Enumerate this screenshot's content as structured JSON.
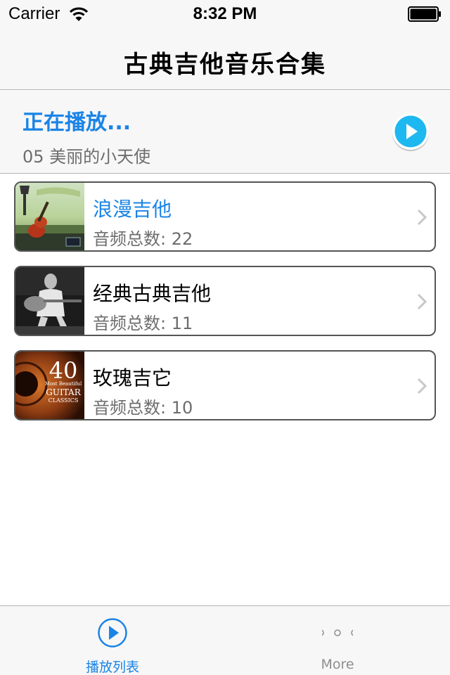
{
  "status_bar": {
    "carrier": "Carrier",
    "time": "8:32 PM"
  },
  "nav": {
    "title": "古典吉他音乐合集"
  },
  "now_playing": {
    "label": "正在播放...",
    "track": "05 美丽的小天使"
  },
  "albums": [
    {
      "title": "浪漫吉他",
      "count": "音频总数: 22",
      "active": true
    },
    {
      "title": "经典古典吉他",
      "count": "音频总数: 11",
      "active": false
    },
    {
      "title": "玫瑰吉它",
      "count": "音频总数: 10",
      "active": false
    }
  ],
  "cover3_text": {
    "number": "40",
    "line1": "Most Beautiful",
    "line2": "GUITAR",
    "line3": "CLASSICS"
  },
  "tabs": [
    {
      "label": "播放列表",
      "icon": "play-circle-icon",
      "selected": true
    },
    {
      "label": "More",
      "icon": "more-dots-icon",
      "selected": false
    }
  ],
  "colors": {
    "accent": "#1a84e6",
    "play_button": "#1eb8f0",
    "secondary_text": "#6d6d6d",
    "bar_bg": "#f7f7f7"
  }
}
